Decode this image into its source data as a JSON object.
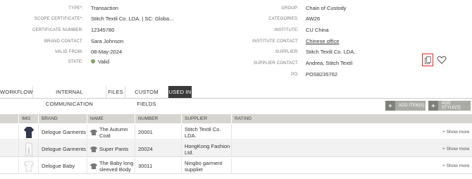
{
  "left_fields": [
    {
      "label": "TYPE*:",
      "value": "Transaction"
    },
    {
      "label": "SCOPE CERTIFICATE*:",
      "value": "Stitch Textil Co. LDA. | SC: Globa..."
    },
    {
      "label": "CERTIFICATE NUMBER:",
      "value": "12345780"
    },
    {
      "label": "BRAND CONTACT:",
      "value": "Sara Johnson"
    },
    {
      "label": "VALID FROM:",
      "value": "08-May-2024"
    },
    {
      "label": "STATE:",
      "value": "Valid"
    }
  ],
  "right_fields": [
    {
      "label": "GROUP:",
      "value": "Chain of Custody"
    },
    {
      "label": "CATEGORIES:",
      "value": "AW26"
    },
    {
      "label": "INSTITUTE:",
      "value": "CU China"
    },
    {
      "label": "INSTITUTE CONTACT:",
      "value": "Chinese office"
    },
    {
      "label": "SUPPLIER:",
      "value": "Stitch Textil Co. LDA."
    },
    {
      "label": "SUPPLIER CONTACT:",
      "value": "Andrea, Stitch Textil"
    },
    {
      "label": "PO:",
      "value": "POS8235762"
    }
  ],
  "state_color": "#7fa85a",
  "highlight_color": "#e0281a",
  "tabs": [
    {
      "label": "WORKFLOW"
    },
    {
      "label": "INTERNAL COMMUNICATION"
    },
    {
      "label": "FILES"
    },
    {
      "label": "CUSTOM FIELDS"
    },
    {
      "label": "USED IN",
      "active": true
    }
  ],
  "actions": {
    "add_items": "ADD ITEM(S)",
    "add_styles": "ADD STYLE(S)"
  },
  "table": {
    "headers": [
      "",
      "IMG",
      "BRAND",
      "NAME",
      "NUMBER",
      "SUPPLIER",
      "RATING"
    ],
    "rows": [
      {
        "brand": "Delogue Garments",
        "name": "The Autumn Coat",
        "number": "20001",
        "supplier": "Stitch Textil Co. LDA.",
        "rating": "",
        "image": "coat-image",
        "show_more": "+ Show more"
      },
      {
        "brand": "Delogue Garments",
        "name": "Super Pants",
        "number": "20024",
        "supplier": "HongKong Fashion Ltd.",
        "rating": "",
        "image": "pants-image",
        "show_more": "+ Show more"
      },
      {
        "brand": "Delogue Baby",
        "name": "The Baby long sleeved Body",
        "number": "30011",
        "supplier": "Ningbo garment supplier",
        "rating": "",
        "image": "body-image",
        "show_more": "+ Show more"
      }
    ]
  }
}
